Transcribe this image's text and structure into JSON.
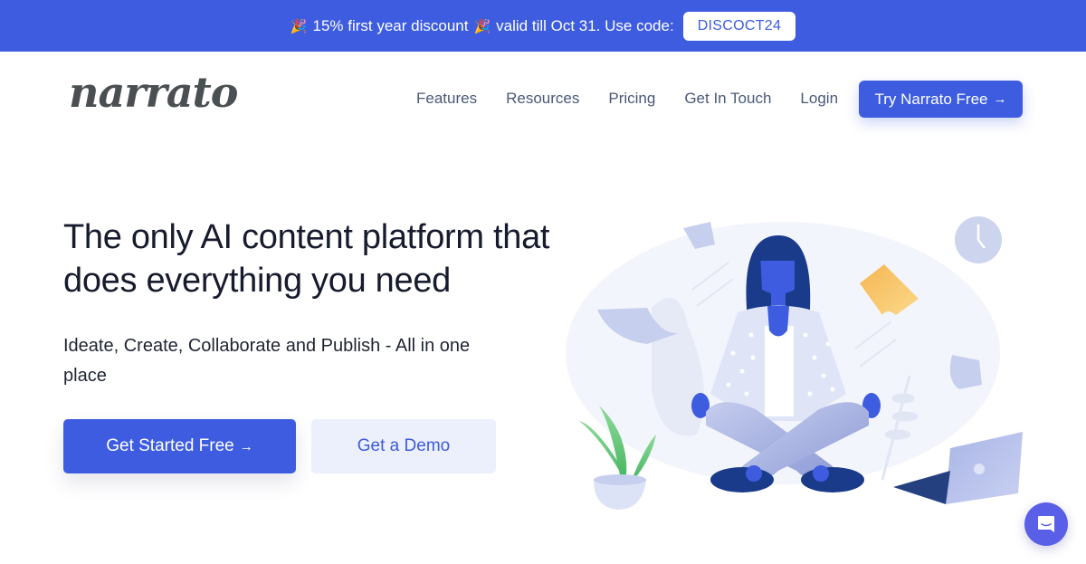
{
  "promo": {
    "emoji": "🎉",
    "text_before": "15% first year discount",
    "text_after": "valid till Oct 31. Use code:",
    "code": "DISCOCT24"
  },
  "header": {
    "logo": "narrato",
    "nav": [
      {
        "label": "Features"
      },
      {
        "label": "Resources"
      },
      {
        "label": "Pricing"
      },
      {
        "label": "Get In Touch"
      },
      {
        "label": "Login"
      }
    ],
    "cta": {
      "label": "Try Narrato Free",
      "icon": "arrow-right-icon",
      "arrow": "→"
    }
  },
  "hero": {
    "title": "The only AI content platform that does everything you need",
    "subtitle": "Ideate, Create, Collaborate and Publish - All in one place",
    "primary_button": {
      "label": "Get Started Free",
      "arrow": "→"
    },
    "secondary_button": {
      "label": "Get a Demo"
    }
  },
  "chat": {
    "icon": "chat-bubble-icon"
  },
  "colors": {
    "brand": "#3d5ce0",
    "secondary_bg": "#eceffc",
    "chat": "#5a5fe8",
    "logo": "#4a4f52"
  }
}
